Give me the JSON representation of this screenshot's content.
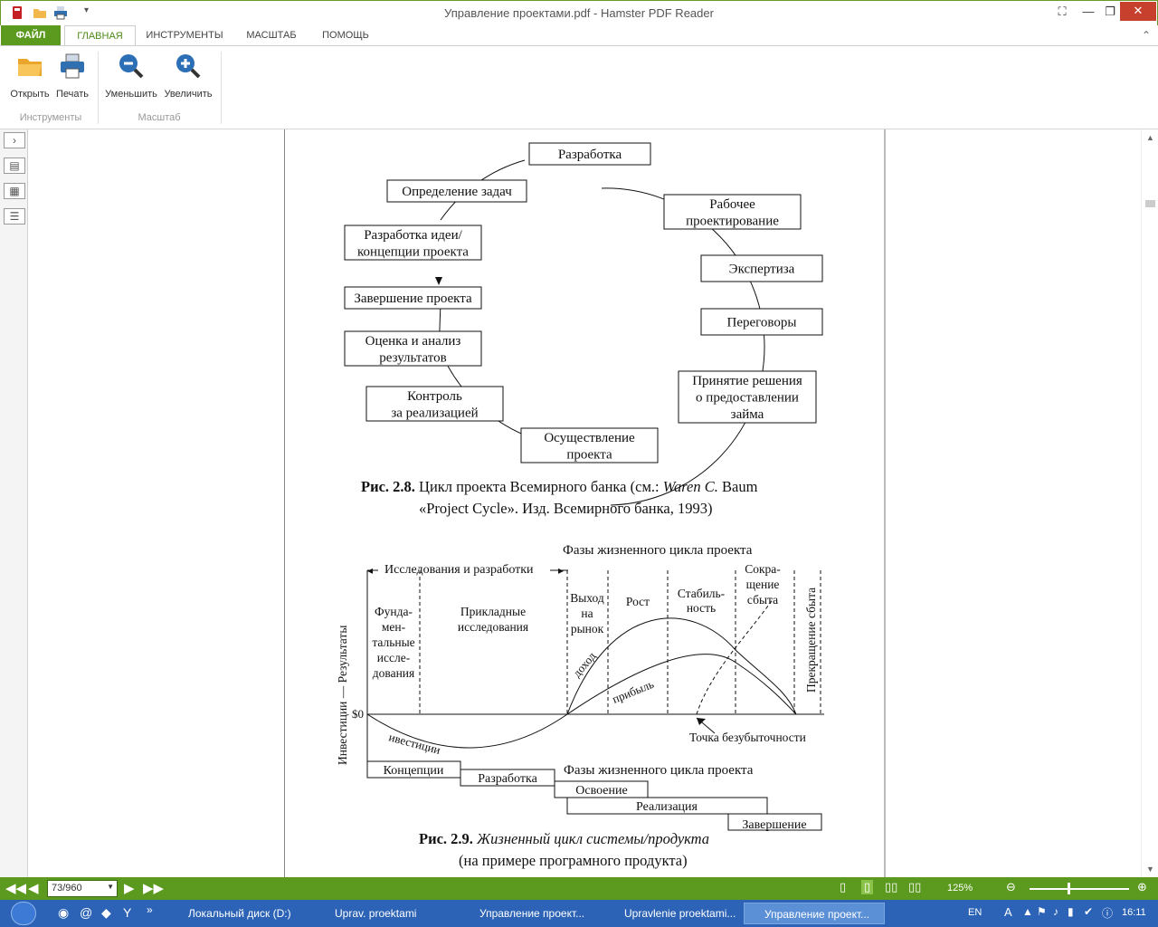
{
  "window": {
    "title": "Управление проектами.pdf - Hamster PDF Reader",
    "close_glyph": "✕",
    "restore_glyph": "❐",
    "minimize_glyph": "—",
    "fullscreen_glyph": "⛶"
  },
  "tabs": [
    {
      "label": "ФАЙЛ"
    },
    {
      "label": "ГЛАВНАЯ"
    },
    {
      "label": "ИНСТРУМЕНТЫ"
    },
    {
      "label": "МАСШТАБ"
    },
    {
      "label": "ПОМОЩЬ"
    }
  ],
  "ribbon": {
    "open_label": "Открыть",
    "print_label": "Печать",
    "zoom_out_label": "Уменьшить",
    "zoom_in_label": "Увеличить",
    "group_tools": "Инструменты",
    "group_zoom": "Масштаб"
  },
  "doc": {
    "cycle_boxes": [
      [
        "Разработка"
      ],
      [
        "Рабочее",
        "проектирование"
      ],
      [
        "Экспертиза"
      ],
      [
        "Переговоры"
      ],
      [
        "Принятие решения",
        "о предоставлении",
        "займа"
      ],
      [
        "Осуществление",
        "проекта"
      ],
      [
        "Контроль",
        "за реализацией"
      ],
      [
        "Оценка и анализ",
        "результатов"
      ],
      [
        "Завершение проекта"
      ],
      [
        "Разработка идеи/",
        "концепции проекта"
      ],
      [
        "Определение задач"
      ]
    ],
    "fig28_bold": "Рис. 2.8.",
    "fig28_a": "Цикл проекта Всемирного банка (см.:",
    "fig28_author": "Waren C.",
    "fig28_b": "Baum",
    "fig28_line2": "«Project Cycle». Изд. Всемирного банка, 1993)",
    "lc_title": "Фазы жизненного цикла проекта",
    "lc_research": "Исследования и разработки",
    "lc_fundamental": [
      "Фунда-",
      "мен-",
      "тальные",
      "иссле-",
      "дования"
    ],
    "lc_applied": [
      "Прикладные",
      "исследования"
    ],
    "lc_market": [
      "Выход",
      "на",
      "рынок"
    ],
    "lc_growth": "Рост",
    "lc_stab": [
      "Стабиль-",
      "ность"
    ],
    "lc_decline": [
      "Сокра-",
      "щение",
      "сбыта"
    ],
    "lc_stop": "Прекращение сбыта",
    "lc_yaxis": "Инвестиции — Результаты",
    "lc_zero": "$0",
    "lc_income": "доход",
    "lc_profit": "прибыль",
    "lc_invest": "ивестиции",
    "lc_breakeven": "Точка безубыточности",
    "lc_phases_title": "Фазы жизненного цикла проекта",
    "lc_phases": [
      "Концепции",
      "Разработка",
      "Освоение",
      "Реализация",
      "Завершение"
    ],
    "fig29_bold": "Рис. 2.9.",
    "fig29_a": "Жизненный цикл системы/продукта",
    "fig29_line2": "(на примере програмного продукта)"
  },
  "status": {
    "page_value": "73/960",
    "zoom": "125%"
  },
  "taskbar": {
    "items": [
      "Локальный диск (D:)",
      "Uprav. proektami",
      "Управление проект...",
      "Upravlenie proektami...",
      "Управление проект..."
    ],
    "lang": "EN",
    "time": "16:11"
  },
  "colors": {
    "accent": "#5b9a1f",
    "taskbar": "#2c63b6",
    "close": "#c7402e"
  }
}
